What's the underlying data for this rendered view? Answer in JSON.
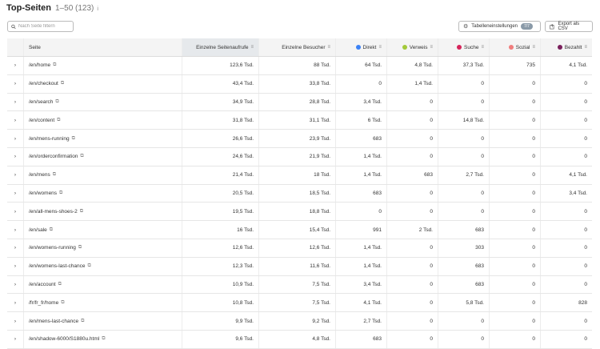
{
  "header": {
    "title": "Top-Seiten",
    "range": "1–50 (123)",
    "info": "i"
  },
  "search": {
    "placeholder": "Nach Seite filtern"
  },
  "buttons": {
    "table_settings": "Tabelleneinstellungen",
    "table_settings_count": "7/7",
    "export": "Export als CSV"
  },
  "columns": {
    "page": "Seite",
    "pageviews": "Einzelne Seitenaufrufe",
    "visitors": "Einzelne Besucher",
    "direct": "Direkt",
    "referral": "Verweis",
    "search": "Suche",
    "social": "Sozial",
    "paid": "Bezahlt"
  },
  "colors": {
    "direct": "#3b82f6",
    "referral": "#a3c93a",
    "search": "#d6245a",
    "social": "#f07d7d",
    "paid": "#7a1f5c"
  },
  "icons": {
    "expand": "chevron-right-icon",
    "external": "external-link-icon",
    "search": "search-icon",
    "settings": "gear-icon",
    "export": "export-icon",
    "sort": "sort-icon"
  },
  "rows": [
    {
      "page": "/en/home",
      "pv": "123,6 Tsd.",
      "v": "88 Tsd.",
      "d": "64 Tsd.",
      "r": "4,8 Tsd.",
      "s": "37,3 Tsd.",
      "so": "735",
      "b": "4,1 Tsd."
    },
    {
      "page": "/en/checkout",
      "pv": "43,4 Tsd.",
      "v": "33,8 Tsd.",
      "d": "0",
      "r": "1,4 Tsd.",
      "s": "0",
      "so": "0",
      "b": "0"
    },
    {
      "page": "/en/search",
      "pv": "34,9 Tsd.",
      "v": "28,8 Tsd.",
      "d": "3,4 Tsd.",
      "r": "0",
      "s": "0",
      "so": "0",
      "b": "0"
    },
    {
      "page": "/en/content",
      "pv": "31,8 Tsd.",
      "v": "31,1 Tsd.",
      "d": "6 Tsd.",
      "r": "0",
      "s": "14,8 Tsd.",
      "so": "0",
      "b": "0"
    },
    {
      "page": "/en/mens-running",
      "pv": "26,6 Tsd.",
      "v": "23,9 Tsd.",
      "d": "683",
      "r": "0",
      "s": "0",
      "so": "0",
      "b": "0"
    },
    {
      "page": "/en/orderconfirmation",
      "pv": "24,6 Tsd.",
      "v": "21,9 Tsd.",
      "d": "1,4 Tsd.",
      "r": "0",
      "s": "0",
      "so": "0",
      "b": "0"
    },
    {
      "page": "/en/mens",
      "pv": "21,4 Tsd.",
      "v": "18 Tsd.",
      "d": "1,4 Tsd.",
      "r": "683",
      "s": "2,7 Tsd.",
      "so": "0",
      "b": "4,1 Tsd."
    },
    {
      "page": "/en/womens",
      "pv": "20,5 Tsd.",
      "v": "18,5 Tsd.",
      "d": "683",
      "r": "0",
      "s": "0",
      "so": "0",
      "b": "3,4 Tsd."
    },
    {
      "page": "/en/all-mens-shoes-2",
      "pv": "19,5 Tsd.",
      "v": "18,8 Tsd.",
      "d": "0",
      "r": "0",
      "s": "0",
      "so": "0",
      "b": "0"
    },
    {
      "page": "/en/sale",
      "pv": "16 Tsd.",
      "v": "15,4 Tsd.",
      "d": "991",
      "r": "2 Tsd.",
      "s": "683",
      "so": "0",
      "b": "0"
    },
    {
      "page": "/en/womens-running",
      "pv": "12,6 Tsd.",
      "v": "12,6 Tsd.",
      "d": "1,4 Tsd.",
      "r": "0",
      "s": "303",
      "so": "0",
      "b": "0"
    },
    {
      "page": "/en/womens-last-chance",
      "pv": "12,3 Tsd.",
      "v": "11,6 Tsd.",
      "d": "1,4 Tsd.",
      "r": "0",
      "s": "683",
      "so": "0",
      "b": "0"
    },
    {
      "page": "/en/account",
      "pv": "10,9 Tsd.",
      "v": "7,5 Tsd.",
      "d": "3,4 Tsd.",
      "r": "0",
      "s": "683",
      "so": "0",
      "b": "0"
    },
    {
      "page": "/fr/fr_fr/home",
      "pv": "10,8 Tsd.",
      "v": "7,5 Tsd.",
      "d": "4,1 Tsd.",
      "r": "0",
      "s": "5,8 Tsd.",
      "so": "0",
      "b": "828"
    },
    {
      "page": "/en/mens-last-chance",
      "pv": "9,9 Tsd.",
      "v": "9,2 Tsd.",
      "d": "2,7 Tsd.",
      "r": "0",
      "s": "0",
      "so": "0",
      "b": "0"
    },
    {
      "page": "/en/shadow-6000/S1880u.html",
      "pv": "9,6 Tsd.",
      "v": "4,8 Tsd.",
      "d": "683",
      "r": "0",
      "s": "0",
      "so": "0",
      "b": "0"
    }
  ]
}
